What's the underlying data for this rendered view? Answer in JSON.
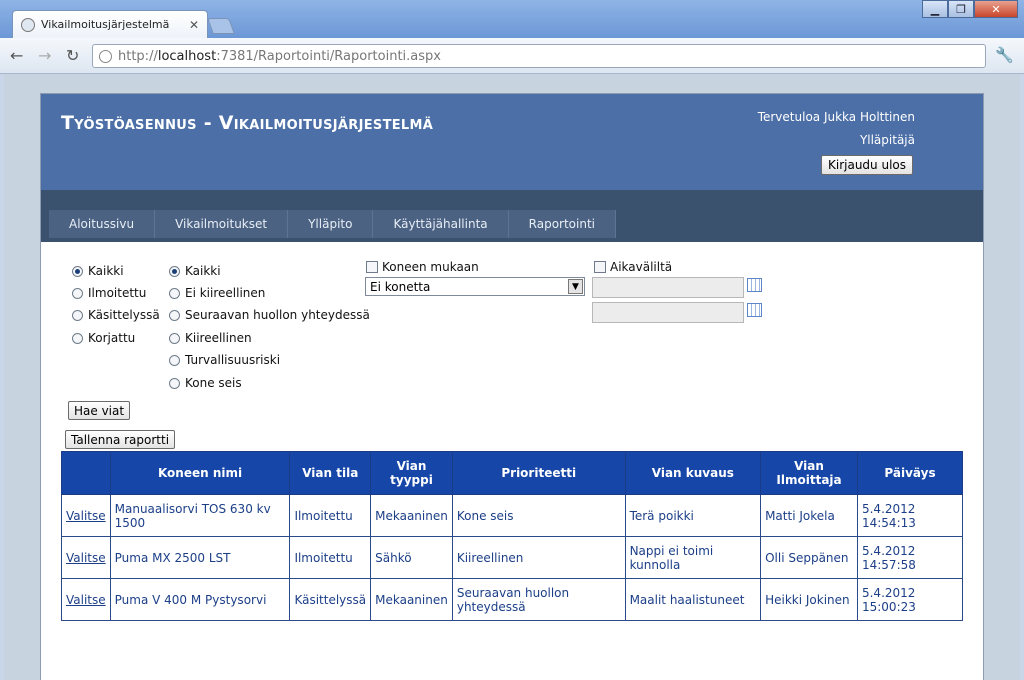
{
  "browser": {
    "tab_title": "Vikailmoitusjärjestelmä",
    "url_prefix": "http://",
    "url_host": "localhost",
    "url_rest": ":7381/Raportointi/Raportointi.aspx"
  },
  "header": {
    "title": "Työstöasennus - Vikailmoitusjärjestelmä",
    "welcome": "Tervetuloa Jukka Holttinen",
    "role": "Ylläpitäjä",
    "logout_label": "Kirjaudu ulos"
  },
  "menu": [
    "Aloitussivu",
    "Vikailmoitukset",
    "Ylläpito",
    "Käyttäjähallinta",
    "Raportointi"
  ],
  "filters": {
    "status": [
      "Kaikki",
      "Ilmoitettu",
      "Käsittelyssä",
      "Korjattu"
    ],
    "priority": [
      "Kaikki",
      "Ei kiireellinen",
      "Seuraavan huollon yhteydessä",
      "Kiireellinen",
      "Turvallisuusriski",
      "Kone seis"
    ],
    "by_machine_label": "Koneen mukaan",
    "machine_selected": "Ei konetta",
    "by_date_label": "Aikaväliltä"
  },
  "buttons": {
    "fetch": "Hae viat",
    "save_report": "Tallenna raportti"
  },
  "table": {
    "headers": [
      "",
      "Koneen nimi",
      "Vian tila",
      "Vian tyyppi",
      "Prioriteetti",
      "Vian kuvaus",
      "Vian Ilmoittaja",
      "Päiväys"
    ],
    "rows": [
      [
        "Valitse",
        "Manuaalisorvi TOS 630 kv 1500",
        "Ilmoitettu",
        "Mekaaninen",
        "Kone seis",
        "Terä poikki",
        "Matti Jokela",
        "5.4.2012 14:54:13"
      ],
      [
        "Valitse",
        "Puma MX 2500 LST",
        "Ilmoitettu",
        "Sähkö",
        "Kiireellinen",
        "Nappi ei toimi kunnolla",
        "Olli Seppänen",
        "5.4.2012 14:57:58"
      ],
      [
        "Valitse",
        "Puma V 400 M Pystysorvi",
        "Käsittelyssä",
        "Mekaaninen",
        "Seuraavan huollon yhteydessä",
        "Maalit haalistuneet",
        "Heikki Jokinen",
        "5.4.2012 15:00:23"
      ]
    ]
  }
}
